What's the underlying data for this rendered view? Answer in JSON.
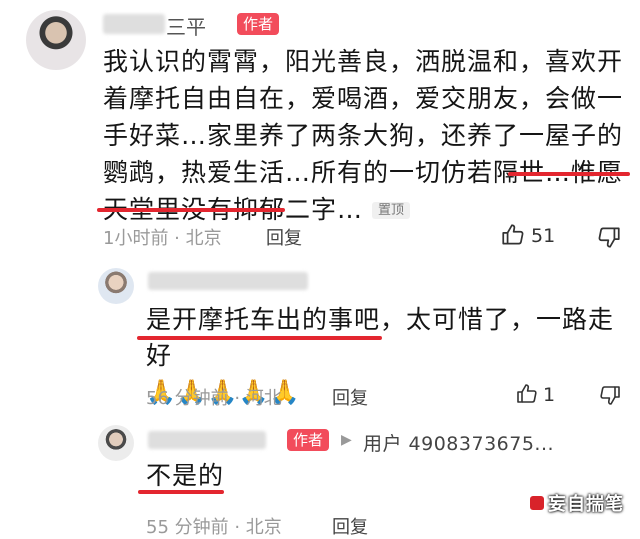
{
  "comments": [
    {
      "name_suffix": "三平",
      "author_tag": "作者",
      "text": "我认识的霄霄，阳光善良，洒脱温和，喜欢开着摩托自由自在，爱喝酒，爱交朋友，会做一手好菜…家里养了两条大狗，还养了一屋子的鹦鹉，热爱生活…所有的一切仿若隔世…惟愿天堂里没有抑郁二字…",
      "pin_tag": "置顶",
      "meta": "1小时前 · 北京",
      "reply_label": "回复",
      "like_count": "51"
    },
    {
      "text": "是开摩托车出的事吧，太可惜了，一路走好",
      "emoji": "🙏🙏🙏🙏🙏",
      "meta": "56 分钟前 · 河北",
      "reply_label": "回复",
      "like_count": "1"
    },
    {
      "author_tag": "作者",
      "reply_to": "用户 4908373675...",
      "text": "不是的",
      "meta": "55 分钟前 · 北京",
      "reply_label": "回复"
    }
  ],
  "watermark": "妄自揣笔",
  "colors": {
    "author_tag": "#f24c5b",
    "underline": "#e3262f"
  },
  "icons": [
    "thumbs-up-icon",
    "thumbs-down-icon",
    "reply-arrow-icon"
  ]
}
